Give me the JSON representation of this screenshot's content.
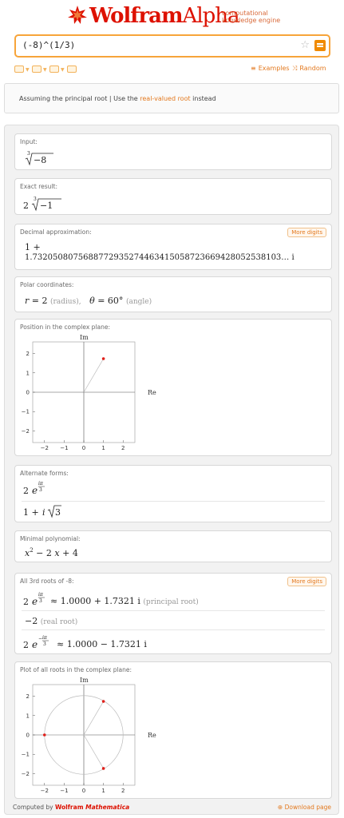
{
  "header": {
    "brand": "Wolfram",
    "brand_alpha": "Alpha",
    "tagline_1": "computational",
    "tagline_2": "knowledge engine"
  },
  "search": {
    "value": "(-8)^(1/3)"
  },
  "toolbar": {
    "examples": "Examples",
    "random": "Random"
  },
  "assumption": {
    "prefix": "Assuming the principal root | Use the ",
    "link": "real-valued root",
    "suffix": " instead"
  },
  "pods": {
    "input": {
      "title": "Input:"
    },
    "exact": {
      "title": "Exact result:"
    },
    "decimal": {
      "title": "Decimal approximation:",
      "button": "More digits",
      "line1": "1 +",
      "line2": "1.7320508075688772935274463415058723669428052538103… i"
    },
    "polar": {
      "title": "Polar coordinates:",
      "r_label": "(radius),",
      "theta_label": "(angle)"
    },
    "position": {
      "title": "Position in the complex plane:"
    },
    "alternate": {
      "title": "Alternate forms:"
    },
    "minimal": {
      "title": "Minimal polynomial:"
    },
    "roots": {
      "title": "All 3rd roots of -8:",
      "button": "More digits",
      "root1_approx": "≈ 1.0000 + 1.7321 i",
      "root1_note": "(principal root)",
      "root2": "−2",
      "root2_note": "(real root)",
      "root3_approx": "≈ 1.0000 − 1.7321 i"
    },
    "plot_roots": {
      "title": "Plot of all roots in the complex plane:"
    }
  },
  "plot1": {
    "im_label": "Im",
    "re_label": "Re",
    "x_ticks": [
      "−2",
      "−1",
      "0",
      "1",
      "2"
    ],
    "y_ticks": [
      "2",
      "1",
      "0",
      "−1",
      "−2"
    ],
    "point": {
      "re": 1,
      "im": 1.7321
    }
  },
  "plot2": {
    "im_label": "Im",
    "re_label": "Re",
    "x_ticks": [
      "−2",
      "−1",
      "0",
      "1",
      "2"
    ],
    "y_ticks": [
      "2",
      "1",
      "0",
      "−1",
      "−2"
    ],
    "points": [
      {
        "re": 1,
        "im": 1.7321
      },
      {
        "re": -2,
        "im": 0
      },
      {
        "re": 1,
        "im": -1.7321
      }
    ]
  },
  "footer": {
    "computed_by": "Computed by",
    "wolfram": "Wolfram",
    "mathematica": "Mathematica",
    "download": "Download page"
  },
  "colors": {
    "accent": "#f08a00",
    "brand": "#dd1100",
    "point": "#e0201b"
  }
}
